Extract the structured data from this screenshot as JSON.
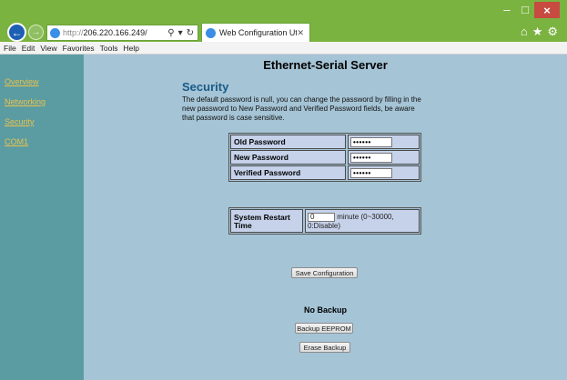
{
  "browser": {
    "url_prefix": "http://",
    "url_host": "206.220.166.249/",
    "tab_title": "Web Configuration Utility",
    "menu": [
      "File",
      "Edit",
      "View",
      "Favorites",
      "Tools",
      "Help"
    ]
  },
  "sidebar": {
    "items": [
      {
        "label": "Overview"
      },
      {
        "label": "Networking"
      },
      {
        "label": "Security"
      },
      {
        "label": "COM1"
      }
    ]
  },
  "page": {
    "title": "Ethernet-Serial Server",
    "section_heading": "Security",
    "description": "The default password is null, you can change the password by filling in the new password to New Password and Verified Password fields, be aware that password is case sensitive."
  },
  "passwords": {
    "rows": [
      {
        "label": "Old Password",
        "value": "••••••"
      },
      {
        "label": "New Password",
        "value": "••••••"
      },
      {
        "label": "Verified Password",
        "value": "••••••"
      }
    ]
  },
  "restart": {
    "label": "System Restart Time",
    "value": "0",
    "hint": "minute (0~30000, 0:Disable)"
  },
  "buttons": {
    "save": "Save Configuration",
    "backup": "Backup EEPROM",
    "erase": "Erase Backup"
  },
  "backup_status": "No Backup",
  "colors": {
    "sidebar_bg": "#5b9ca3",
    "content_bg": "#a5c4d6",
    "heading": "#1a5a86",
    "nav_link": "#e8c24a",
    "chrome": "#7ab340"
  }
}
